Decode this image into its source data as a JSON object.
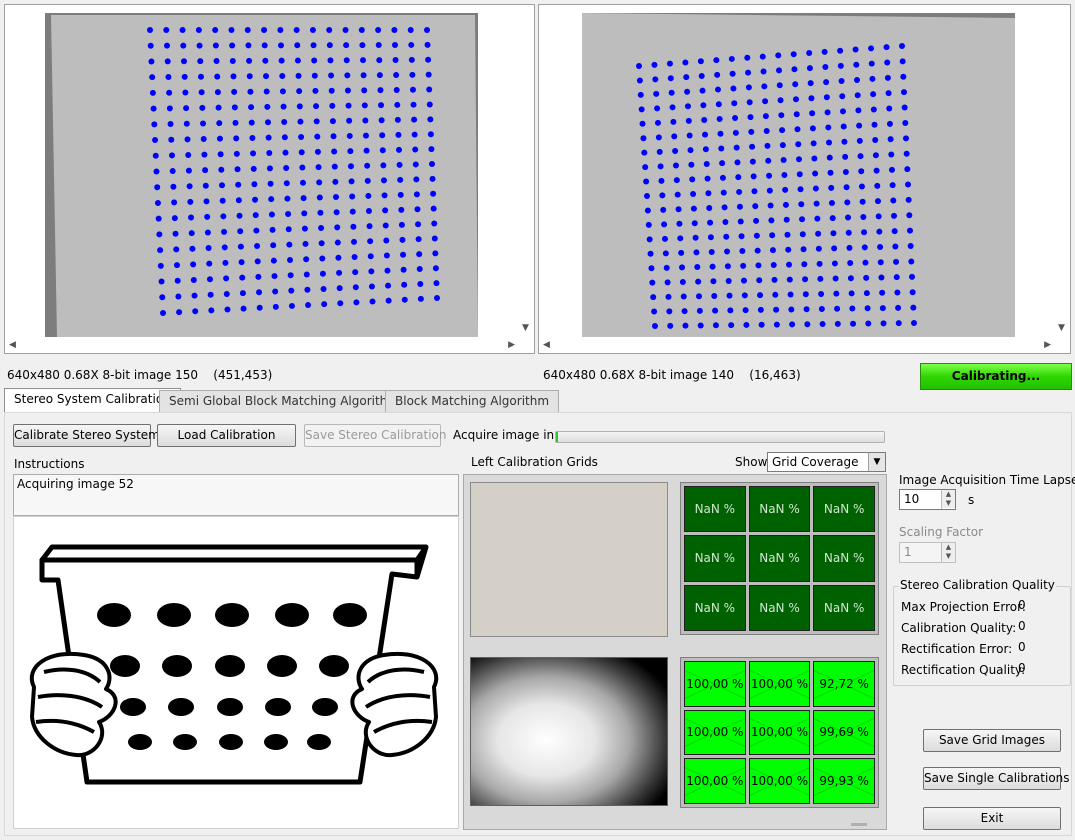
{
  "left_camera": {
    "status": "640x480 0.68X 8-bit image 150",
    "coords": "(451,453)"
  },
  "right_camera": {
    "status": "640x480 0.68X 8-bit image 140",
    "coords": "(16,463)"
  },
  "calibrating_badge": "Calibrating...",
  "tabs": [
    {
      "label": "Stereo System Calibration"
    },
    {
      "label": "Semi Global Block Matching Algorithm"
    },
    {
      "label": "Block Matching Algorithm"
    }
  ],
  "toolbar": {
    "calibrate_label": "Calibrate Stereo System",
    "load_label": "Load Calibration",
    "save_label": "Save Stereo Calibration",
    "acquire_label": "Acquire image in...",
    "acquire_progress": 0.005
  },
  "instructions": {
    "title": "Instructions",
    "text": "Acquiring image 52"
  },
  "grids": {
    "title": "Left Calibration Grids",
    "show_label": "Show",
    "show_value": "Grid Coverage",
    "top_cells": [
      "NaN %",
      "NaN %",
      "NaN %",
      "NaN %",
      "NaN %",
      "NaN %",
      "NaN %",
      "NaN %",
      "NaN %"
    ],
    "bottom_cells": [
      "100,00 %",
      "100,00 %",
      "92,72 %",
      "100,00 %",
      "100,00 %",
      "99,69 %",
      "100,00 %",
      "100,00 %",
      "99,93 %"
    ]
  },
  "acquisition": {
    "label": "Image Acquisition Time Lapse",
    "value": "10",
    "unit": "s"
  },
  "scaling": {
    "label": "Scaling Factor",
    "value": "1"
  },
  "quality": {
    "title": "Stereo Calibration Quality",
    "rows": [
      {
        "label": "Max Projection Error:",
        "value": "0"
      },
      {
        "label": "Calibration Quality:",
        "value": "0"
      },
      {
        "label": "Rectification Error:",
        "value": "0"
      },
      {
        "label": "Rectification Quality:",
        "value": "0"
      }
    ]
  },
  "actions": {
    "save_grid_label": "Save Grid Images",
    "save_single_label": "Save Single Calibrations",
    "exit_label": "Exit"
  },
  "colors": {
    "dot": "#0000ff",
    "cell_dark": "#006100",
    "cell_bright": "#00ff00",
    "badge": "#2fd600"
  }
}
